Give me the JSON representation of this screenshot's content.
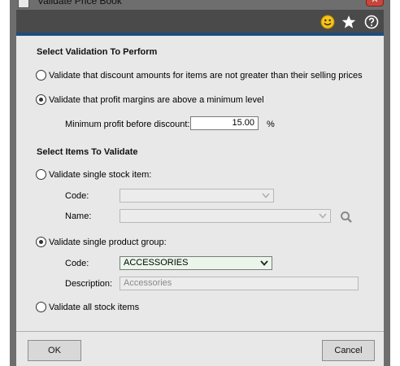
{
  "window": {
    "title": "Validate Price Book"
  },
  "toolbar": {
    "icons": [
      "smiley-icon",
      "star-icon",
      "help-icon"
    ]
  },
  "validation": {
    "header": "Select Validation To Perform",
    "option_discount": "Validate that discount amounts for items are not greater than their selling prices",
    "option_margin": "Validate that profit margins are above a minimum level",
    "selected": "margin",
    "min_profit_label": "Minimum profit before discount:",
    "min_profit_value": "15.00",
    "min_profit_unit": "%"
  },
  "items": {
    "header": "Select Items To Validate",
    "single_item": {
      "label": "Validate single stock item:",
      "code_label": "Code:",
      "code_value": "",
      "name_label": "Name:",
      "name_value": ""
    },
    "product_group": {
      "label": "Validate single product group:",
      "code_label": "Code:",
      "code_value": "ACCESSORIES",
      "description_label": "Description:",
      "description_value": "Accessories"
    },
    "all_items": {
      "label": "Validate all stock items"
    },
    "selected": "product_group"
  },
  "footer": {
    "ok_label": "OK",
    "cancel_label": "Cancel"
  },
  "colors": {
    "chrome": "#6e6e6e",
    "accent_line": "#1f4d7a",
    "panel": "#e8e8e8",
    "close": "#c9463d"
  }
}
